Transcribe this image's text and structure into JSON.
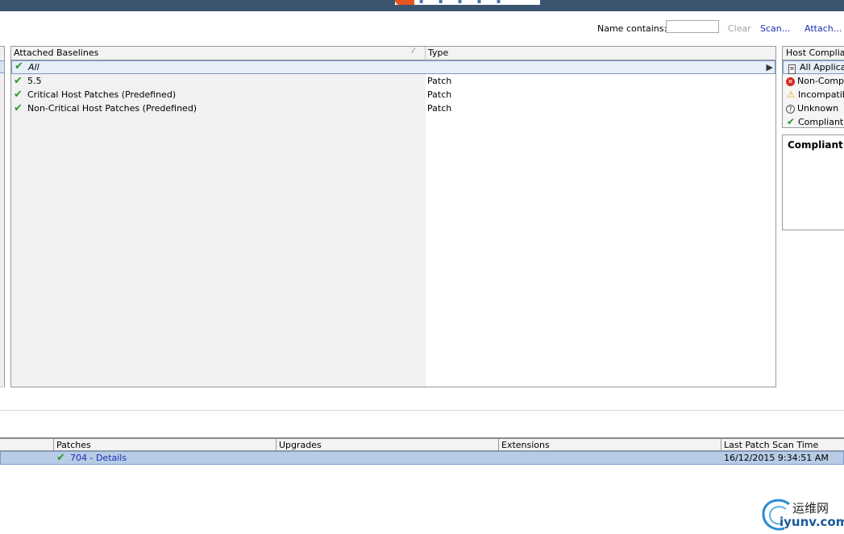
{
  "filter": {
    "label": "Name contains:",
    "value": "",
    "clear": "Clear",
    "scan": "Scan...",
    "attach": "Attach..."
  },
  "baselines": {
    "columns": [
      "Attached Baselines",
      "Type"
    ],
    "all_row": "All",
    "rows": [
      {
        "name": "5.5",
        "type": "Patch"
      },
      {
        "name": "Critical Host Patches (Predefined)",
        "type": "Patch"
      },
      {
        "name": "Non-Critical Host Patches (Predefined)",
        "type": "Patch"
      }
    ]
  },
  "compliance": {
    "header": "Host Complian",
    "items": [
      {
        "label": "All Applica",
        "icon": "document-icon"
      },
      {
        "label": "Non-Comp",
        "icon": "error-icon"
      },
      {
        "label": "Incompatib",
        "icon": "warning-icon"
      },
      {
        "label": "Unknown",
        "icon": "unknown-icon"
      },
      {
        "label": "Compliant",
        "icon": "check-icon"
      }
    ],
    "detail_title": "Compliant"
  },
  "summary": {
    "columns": [
      "Patches",
      "Upgrades",
      "Extensions",
      "Last Patch Scan Time"
    ],
    "row": {
      "patches": "704 - Details",
      "upgrades": "",
      "extensions": "",
      "scan_time": "16/12/2015 9:34:51 AM"
    }
  },
  "watermark": {
    "cn": "运维网",
    "en": "iyunv.com"
  },
  "colors": {
    "banner": "#3c5470",
    "selection": "#e6eef8",
    "link": "#1a2fb0",
    "ok": "#2a9a2a"
  }
}
